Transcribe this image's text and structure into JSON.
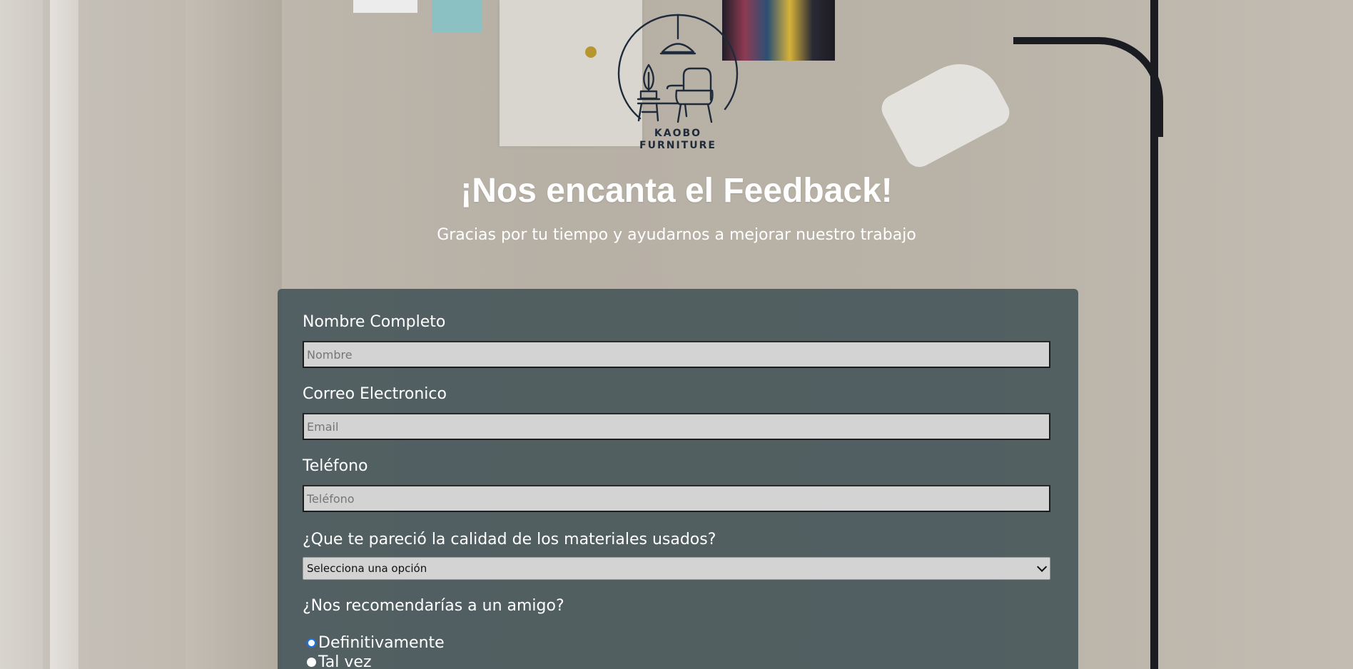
{
  "brand": {
    "logo_line1": "KAOBO",
    "logo_line2": "FURNITURE"
  },
  "header": {
    "title": "¡Nos encanta el Feedback!",
    "subtitle": "Gracias por tu tiempo y ayudarnos a mejorar nuestro trabajo"
  },
  "form": {
    "name": {
      "label": "Nombre Completo",
      "placeholder": "Nombre",
      "value": ""
    },
    "email": {
      "label": "Correo Electronico",
      "placeholder": "Email",
      "value": ""
    },
    "phone": {
      "label": "Teléfono",
      "placeholder": "Teléfono",
      "value": ""
    },
    "quality": {
      "label": "¿Que te pareció la calidad de los materiales usados?",
      "selected": "Selecciona una opción"
    },
    "recommend": {
      "label": "¿Nos recomendarías a un amigo?",
      "options": [
        {
          "label": "Definitivamente",
          "checked": true
        },
        {
          "label": "Tal vez",
          "checked": false
        }
      ]
    }
  },
  "colors": {
    "card_background": "#34484e",
    "input_background": "#d3d3d3",
    "text": "#ffffff",
    "radio_accent": "#1a73e8"
  }
}
